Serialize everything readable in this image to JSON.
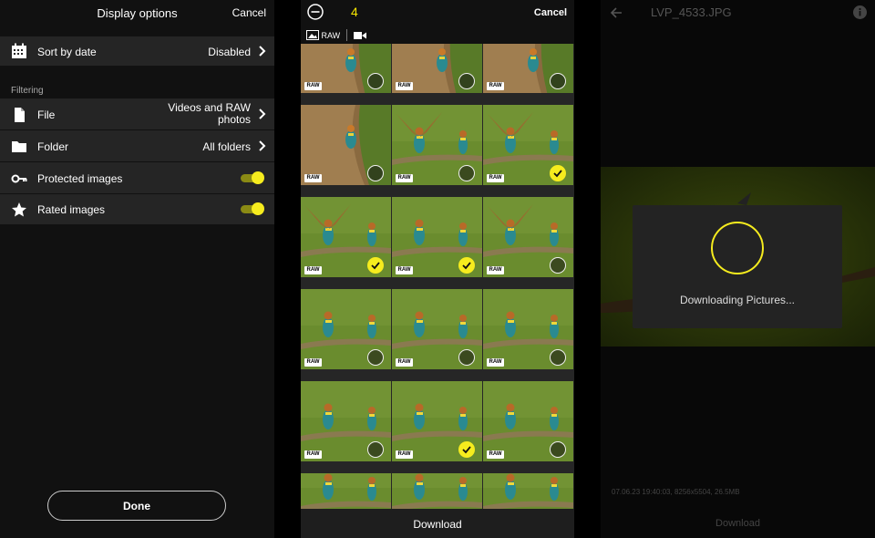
{
  "left": {
    "title": "Display options",
    "cancel": "Cancel",
    "sort": {
      "label": "Sort by date",
      "value": "Disabled",
      "icon": "calendar-icon"
    },
    "filtering_title": "Filtering",
    "file": {
      "label": "File",
      "value_line1": "Videos and RAW",
      "value_line2": "photos",
      "icon": "file-icon"
    },
    "folder": {
      "label": "Folder",
      "value": "All folders",
      "icon": "folder-icon"
    },
    "protected": {
      "label": "Protected images",
      "on": true,
      "icon": "key-icon"
    },
    "rated": {
      "label": "Rated images",
      "on": true,
      "icon": "star-icon"
    },
    "done": "Done"
  },
  "middle": {
    "count": "4",
    "cancel": "Cancel",
    "raw_filter": "RAW",
    "raw_badge": "RAW",
    "download": "Download",
    "tiles": [
      {
        "selected": false
      },
      {
        "selected": false
      },
      {
        "selected": false
      },
      {
        "selected": false
      },
      {
        "selected": false
      },
      {
        "selected": true
      },
      {
        "selected": true
      },
      {
        "selected": true
      },
      {
        "selected": false
      },
      {
        "selected": false
      },
      {
        "selected": false
      },
      {
        "selected": false
      },
      {
        "selected": false
      },
      {
        "selected": true
      },
      {
        "selected": false
      }
    ]
  },
  "right": {
    "title": "LVP_4533.JPG",
    "dialog_text": "Downloading Pictures...",
    "meta": "07.06.23 19:40:03, 8256x5504, 26.5MB",
    "download": "Download"
  },
  "colors": {
    "accent": "#f6ec1e",
    "panel": "#252525"
  }
}
